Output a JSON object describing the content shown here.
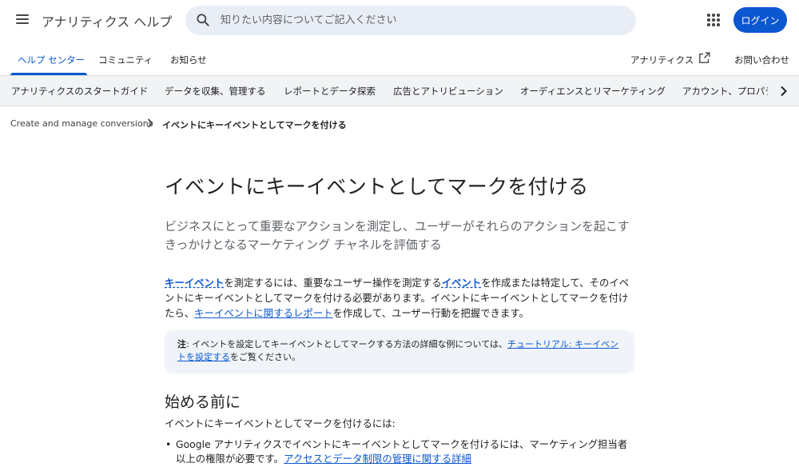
{
  "header": {
    "product_name": "アナリティクス ヘルプ",
    "search_placeholder": "知りたい内容についてご記入ください",
    "login_label": "ログイン"
  },
  "tabs": {
    "help_center": "ヘルプ センター",
    "community": "コミュニティ",
    "announcements": "お知らせ",
    "analytics_link": "アナリティクス",
    "contact": "お問い合わせ"
  },
  "categories": [
    "アナリティクスのスタートガイド",
    "データを収集、管理する",
    "レポートとデータ探索",
    "広告とアトリビューション",
    "オーディエンスとリマーケティング",
    "アカウント、プロパティ、データ ストリーム"
  ],
  "breadcrumb": {
    "parent": "Create and manage conversions",
    "current": "イベントにキーイベントとしてマークを付ける"
  },
  "article": {
    "title": "イベントにキーイベントとしてマークを付ける",
    "subtitle": "ビジネスにとって重要なアクションを測定し、ユーザーがそれらのアクションを起こすきっかけとなるマーケティング チャネルを評価する",
    "para": {
      "term_key_event": "キーイベント",
      "text1": "を測定するには、重要なユーザー操作を測定する",
      "term_event": "イベント",
      "text2": "を作成または特定して、そのイベントにキーイベントとしてマークを付ける必要があります。イベントにキーイベントとしてマークを付けたら、",
      "link_report": "キーイベントに関するレポート",
      "text3": "を作成して、ユーザー行動を把握できます。"
    },
    "note": {
      "label": "注",
      "text": ": イベントを設定してキーイベントとしてマークする方法の詳細な例については、",
      "link": "チュートリアル: キーイベントを設定する",
      "suffix": "をご覧ください。"
    },
    "before_you_begin": {
      "heading": "始める前に",
      "intro": "イベントにキーイベントとしてマークを付けるには:",
      "bullet1_text": "Google アナリティクスでイベントにキーイベントとしてマークを付けるには、マーケティング担当者以上の権限が必要です。",
      "bullet1_link": "アクセスとデータ制限の管理に関する詳細"
    }
  },
  "colors": {
    "accent": "#0b57d0",
    "search_bg": "#e9eef6",
    "nav_bg": "#f1f3f4",
    "note_bg": "#f0f4f9"
  },
  "icons": [
    "menu-icon",
    "search-icon",
    "apps-icon",
    "open-in-new-icon",
    "chevron-right-icon"
  ]
}
